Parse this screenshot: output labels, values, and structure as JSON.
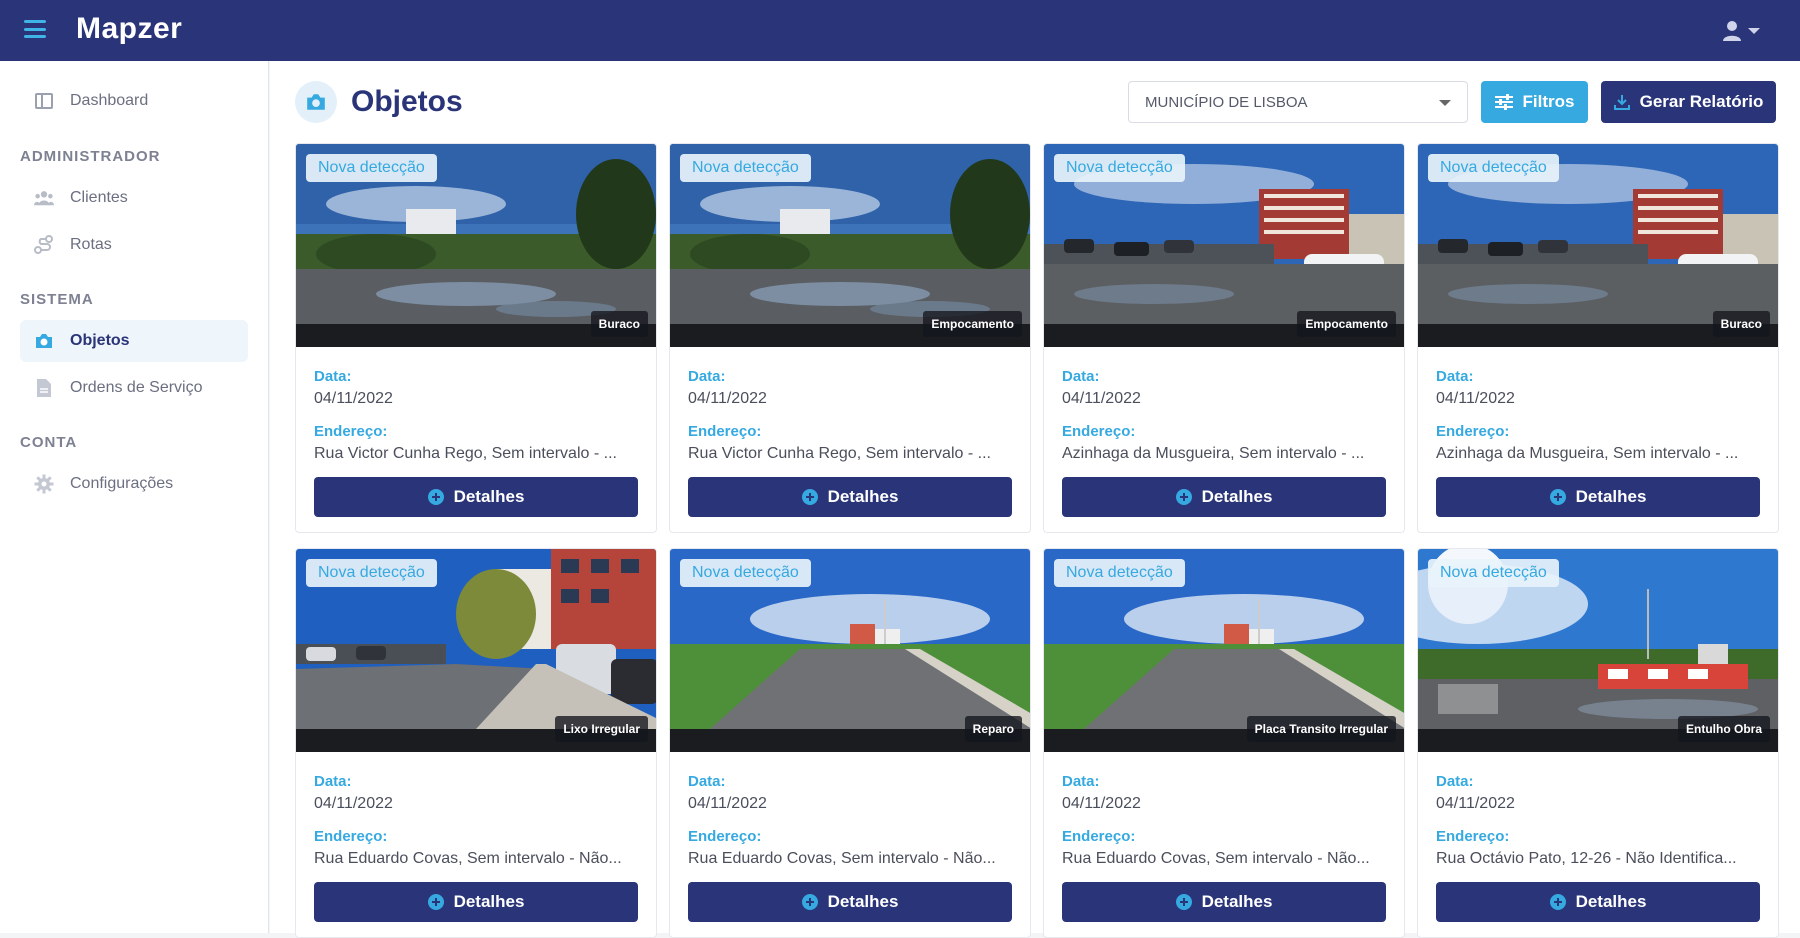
{
  "app": {
    "brand": "Mapzer"
  },
  "sidebar": {
    "dashboard": "Dashboard",
    "sections": {
      "admin": "ADMINISTRADOR",
      "system": "SISTEMA",
      "account": "CONTA"
    },
    "items": {
      "clientes": "Clientes",
      "rotas": "Rotas",
      "objetos": "Objetos",
      "ordens": "Ordens de Serviço",
      "config": "Configurações"
    }
  },
  "header": {
    "title": "Objetos",
    "municipality": "MUNICÍPIO DE LISBOA",
    "filters_label": "Filtros",
    "report_label": "Gerar Relatório"
  },
  "labels": {
    "date": "Data:",
    "address": "Endereço:",
    "details": "Detalhes",
    "new_detection": "Nova detecção"
  },
  "cards": [
    {
      "type": "Buraco",
      "date": "04/11/2022",
      "address": "Rua Victor Cunha Rego, Sem intervalo - ...",
      "scene": "field"
    },
    {
      "type": "Empocamento",
      "date": "04/11/2022",
      "address": "Rua Victor Cunha Rego, Sem intervalo - ...",
      "scene": "field"
    },
    {
      "type": "Empocamento",
      "date": "04/11/2022",
      "address": "Azinhaga da Musgueira, Sem intervalo - ...",
      "scene": "parking"
    },
    {
      "type": "Buraco",
      "date": "04/11/2022",
      "address": "Azinhaga da Musgueira, Sem intervalo - ...",
      "scene": "parking"
    },
    {
      "type": "Lixo Irregular",
      "date": "04/11/2022",
      "address": "Rua Eduardo Covas, Sem intervalo - Não...",
      "scene": "street"
    },
    {
      "type": "Reparo",
      "date": "04/11/2022",
      "address": "Rua Eduardo Covas, Sem intervalo - Não...",
      "scene": "road"
    },
    {
      "type": "Placa Transito Irregular",
      "date": "04/11/2022",
      "address": "Rua Eduardo Covas, Sem intervalo - Não...",
      "scene": "road"
    },
    {
      "type": "Entulho Obra",
      "date": "04/11/2022",
      "address": "Rua Octávio Pato, 12-26 - Não Identifica...",
      "scene": "sunny"
    }
  ],
  "colors": {
    "primary": "#2a3478",
    "accent": "#35a9e0"
  }
}
